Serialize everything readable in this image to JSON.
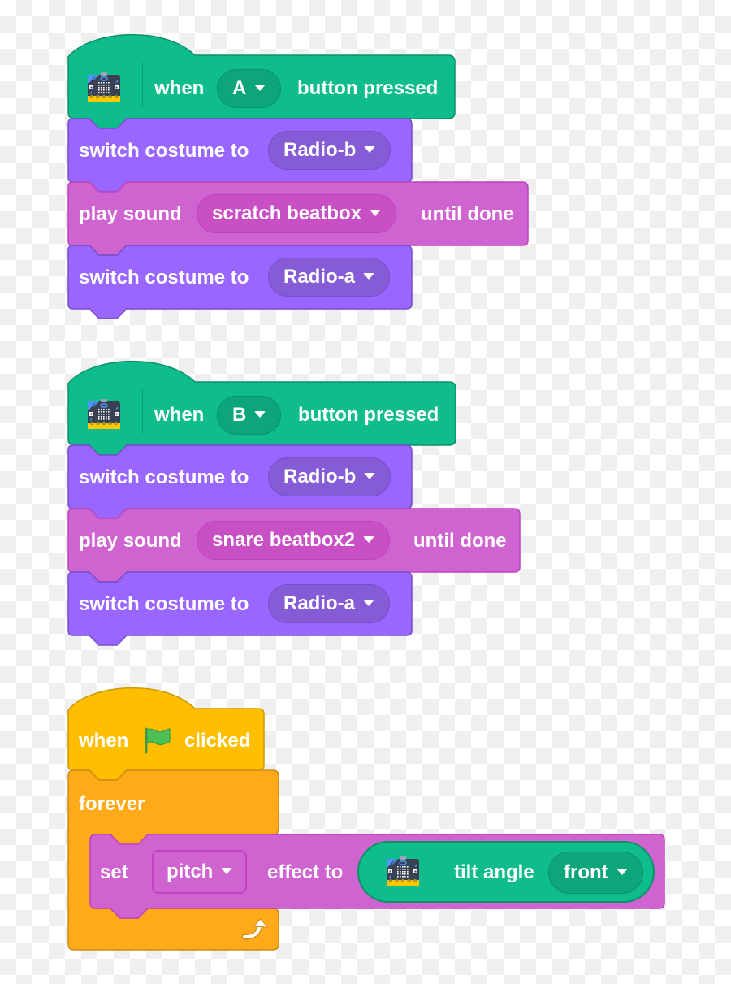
{
  "colors": {
    "microbit_green": "#0fbd8c",
    "looks_purple": "#9966ff",
    "sound_magenta": "#cf63cf",
    "events_yellow": "#ffbf00",
    "control_orange": "#ffab19"
  },
  "scripts": [
    {
      "hat": {
        "icon": "microbit-icon",
        "prefix": "when",
        "button_value": "A",
        "suffix": "button pressed"
      },
      "blocks": [
        {
          "text": "switch costume to",
          "value": "Radio-b"
        },
        {
          "text": "play sound",
          "value": "scratch beatbox",
          "suffix": "until done"
        },
        {
          "text": "switch costume to",
          "value": "Radio-a"
        }
      ]
    },
    {
      "hat": {
        "icon": "microbit-icon",
        "prefix": "when",
        "button_value": "B",
        "suffix": "button pressed"
      },
      "blocks": [
        {
          "text": "switch costume to",
          "value": "Radio-b"
        },
        {
          "text": "play sound",
          "value": "snare beatbox2",
          "suffix": "until done"
        },
        {
          "text": "switch costume to",
          "value": "Radio-a"
        }
      ]
    },
    {
      "hat": {
        "prefix": "when",
        "icon": "green-flag-icon",
        "suffix": "clicked"
      },
      "forever": {
        "label": "forever",
        "icon": "loop-arrow-icon",
        "inner": {
          "text": "set",
          "effect": "pitch",
          "middle": "effect to",
          "reporter": {
            "icon": "microbit-icon",
            "text": "tilt angle",
            "value": "front"
          }
        }
      }
    }
  ]
}
